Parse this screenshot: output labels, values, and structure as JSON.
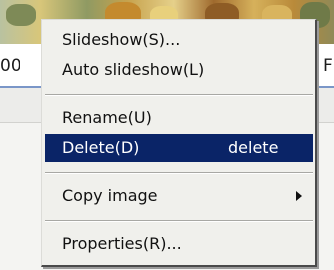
{
  "background_window": {
    "left_text_fragment": "00",
    "right_text_fragment": "F"
  },
  "context_menu": {
    "items": [
      {
        "label": "Slideshow(S)..."
      },
      {
        "label": "Auto slideshow(L)"
      },
      {
        "label": "Rename(U)"
      },
      {
        "label": "Delete(D)",
        "shortcut": "delete",
        "highlighted": true
      },
      {
        "label": "Copy image",
        "has_submenu": true
      },
      {
        "label": "Properties(R)..."
      }
    ],
    "colors": {
      "highlight_background": "#0a2467",
      "highlight_text": "#ffffff",
      "menu_background": "#f0f0ec"
    }
  }
}
